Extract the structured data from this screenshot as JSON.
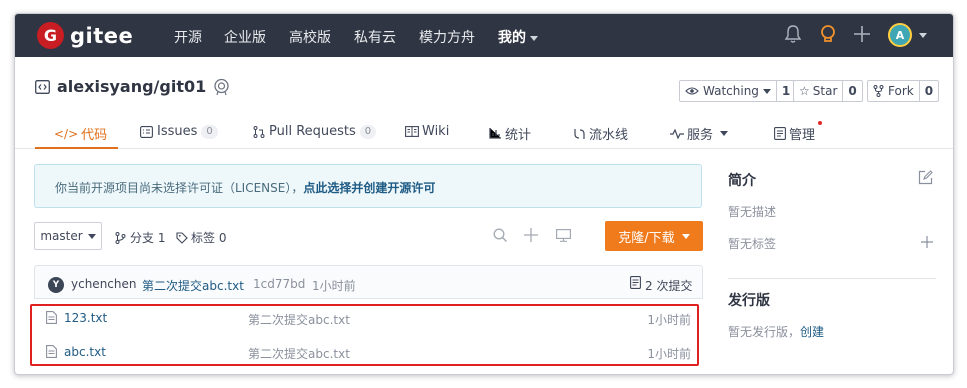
{
  "nav": {
    "brand": "gitee",
    "logo_letter": "G",
    "items": [
      {
        "label": "开源"
      },
      {
        "label": "企业版"
      },
      {
        "label": "高校版"
      },
      {
        "label": "私有云"
      },
      {
        "label": "模力方舟"
      },
      {
        "label": "我的"
      }
    ],
    "avatar_letter": "A",
    "icons": [
      "bell-icon",
      "lightbulb-icon",
      "plus-icon"
    ]
  },
  "repo": {
    "name": "alexisyang/git01",
    "watch_label": "Watching",
    "watch_count": "1",
    "star_label": "Star",
    "star_count": "0",
    "fork_label": "Fork",
    "fork_count": "0"
  },
  "tabs": [
    {
      "label": "代码",
      "prefix": "</>"
    },
    {
      "label": "Issues",
      "count": "0"
    },
    {
      "label": "Pull Requests",
      "count": "0"
    },
    {
      "label": "Wiki"
    },
    {
      "label": "统计"
    },
    {
      "label": "流水线"
    },
    {
      "label": "服务"
    },
    {
      "label": "管理"
    }
  ],
  "notice": {
    "text": "你当前开源项目尚未选择许可证（LICENSE），",
    "link": "点此选择并创建开源许可"
  },
  "branch": {
    "current": "master",
    "branches": "分支 1",
    "tags": "标签 0",
    "clone_label": "克隆/下载"
  },
  "commit": {
    "avatar_letter": "Y",
    "author": "ychenchen",
    "message": "第二次提交abc.txt",
    "hash": "1cd77bd",
    "time": "1小时前",
    "count_label": "2 次提交"
  },
  "files": [
    {
      "name": "123.txt",
      "message": "第二次提交abc.txt",
      "time": "1小时前"
    },
    {
      "name": "abc.txt",
      "message": "第二次提交abc.txt",
      "time": "1小时前"
    }
  ],
  "sidebar": {
    "intro_title": "简介",
    "no_desc": "暂无描述",
    "no_tags": "暂无标签",
    "release_title": "发行版",
    "no_release": "暂无发行版，",
    "create_link": "创建"
  },
  "colors": {
    "nav_bg": "#2f3542",
    "accent": "#e0701b",
    "clone_bg": "#f07b1d",
    "highlight": "#e02020"
  }
}
